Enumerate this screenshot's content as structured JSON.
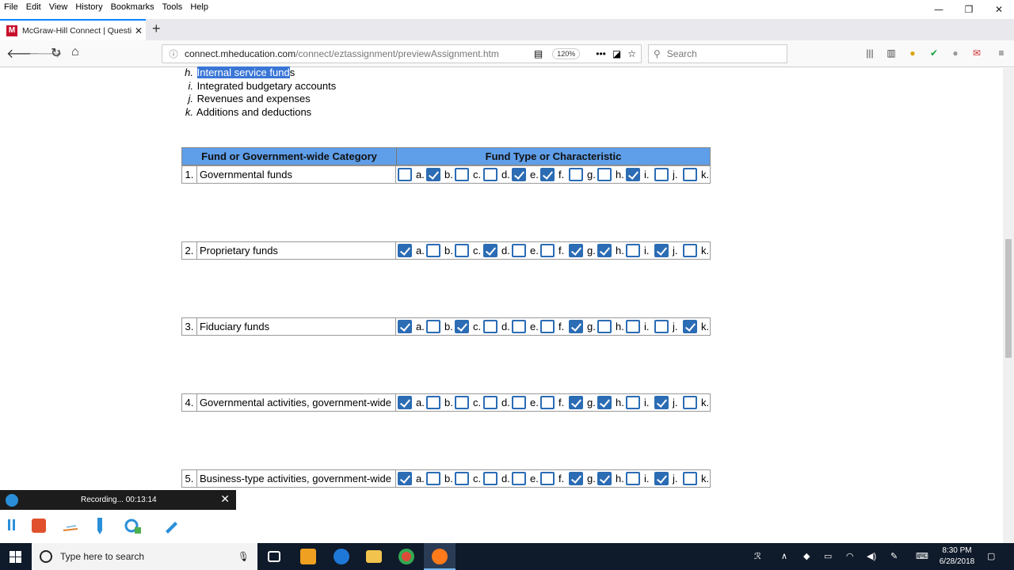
{
  "menu": [
    "File",
    "Edit",
    "View",
    "History",
    "Bookmarks",
    "Tools",
    "Help"
  ],
  "window_controls": {
    "minimize": "—",
    "restore": "❐",
    "close": "✕"
  },
  "tab": {
    "favicon": "M",
    "title": "McGraw-Hill Connect | Questio",
    "close": "✕",
    "new": "+"
  },
  "nav": {
    "back": "🡐",
    "forward": "🡒",
    "reload": "↻",
    "home": "⌂",
    "url_domain": "connect.mheducation.com",
    "url_path": "/connect/eztassignment/previewAssignment.htm",
    "zoom": "120%",
    "more": "•••",
    "search_placeholder": "Search"
  },
  "list": [
    {
      "key": "h.",
      "text_selected": "Internal service fund",
      "text_rest": "s"
    },
    {
      "key": "i.",
      "text": "Integrated budgetary accounts"
    },
    {
      "key": "j.",
      "text": "Revenues and expenses"
    },
    {
      "key": "k.",
      "text": "Additions and deductions"
    }
  ],
  "table": {
    "header_category": "Fund or Government-wide Category",
    "header_type": "Fund Type or Characteristic",
    "option_labels": [
      "a.",
      "b.",
      "c.",
      "d.",
      "e.",
      "f.",
      "g.",
      "h.",
      "i.",
      "j.",
      "k."
    ],
    "rows": [
      {
        "num": "1.",
        "category": "Governmental funds",
        "checked": [
          false,
          true,
          false,
          false,
          true,
          true,
          false,
          false,
          true,
          false,
          false
        ]
      },
      {
        "num": "2.",
        "category": "Proprietary funds",
        "checked": [
          true,
          false,
          false,
          true,
          false,
          false,
          true,
          true,
          false,
          true,
          false
        ]
      },
      {
        "num": "3.",
        "category": "Fiduciary funds",
        "checked": [
          true,
          false,
          true,
          false,
          false,
          false,
          true,
          false,
          false,
          false,
          true
        ]
      },
      {
        "num": "4.",
        "category": "Governmental activities, government-wide",
        "checked": [
          true,
          false,
          false,
          false,
          false,
          false,
          true,
          true,
          false,
          true,
          false
        ]
      },
      {
        "num": "5.",
        "category": "Business-type activities, government-wide",
        "checked": [
          true,
          false,
          false,
          false,
          false,
          false,
          true,
          true,
          false,
          true,
          false
        ]
      }
    ]
  },
  "recording": {
    "status": "Recording... 00:13:14",
    "close": "✕"
  },
  "taskbar": {
    "search_placeholder": "Type here to search",
    "time": "8:30 PM",
    "date": "6/28/2018"
  },
  "colors": {
    "header_bg": "#5f9ee8",
    "checkbox": "#2b6cb4",
    "selection": "#3a76d6",
    "taskbar": "#0f1a2a"
  }
}
